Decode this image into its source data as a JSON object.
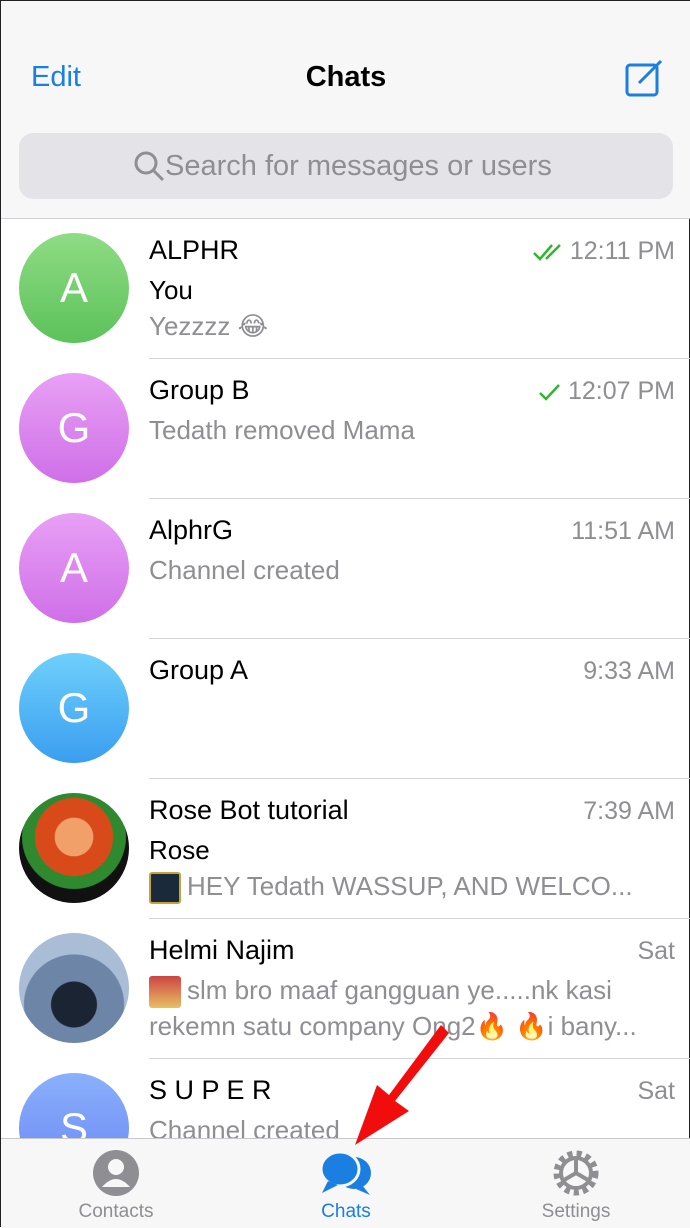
{
  "header": {
    "edit_label": "Edit",
    "title": "Chats",
    "compose_icon": "compose-icon"
  },
  "search": {
    "placeholder": "Search for messages or users"
  },
  "chats": [
    {
      "initial": "A",
      "name": "ALPHR",
      "time": "12:11 PM",
      "status": "read",
      "sender": "You",
      "message": "Yezzzz 😂",
      "color_top": "#8fdc84",
      "color_bottom": "#5cc25a"
    },
    {
      "initial": "G",
      "name": "Group B",
      "time": "12:07 PM",
      "status": "sent",
      "message": "Tedath removed Mama",
      "color_top": "#e8a0f5",
      "color_bottom": "#cf6fe8"
    },
    {
      "initial": "A",
      "name": "AlphrG",
      "time": "11:51 AM",
      "message": "Channel created",
      "color_top": "#e8a0f5",
      "color_bottom": "#cf6fe8"
    },
    {
      "initial": "G",
      "name": "Group A",
      "time": "9:33 AM",
      "message": "",
      "color_top": "#6fd0fb",
      "color_bottom": "#3a9ef0"
    },
    {
      "name": "Rose Bot tutorial",
      "time": "7:39 AM",
      "sender": "Rose",
      "message": "HEY Tedath WASSUP, AND WELCO..."
    },
    {
      "name": "Helmi Najim",
      "time": "Sat",
      "message": "slm bro maaf gangguan ye.....nk kasi",
      "message2": "rekemn satu company Ong2🔥 🔥i bany..."
    },
    {
      "initial": "S",
      "name": "S U P E R",
      "time": "Sat",
      "message": "Channel created",
      "color_top": "#8ab0fb",
      "color_bottom": "#6a86f5"
    }
  ],
  "tabs": [
    {
      "label": "Contacts",
      "icon": "person-icon"
    },
    {
      "label": "Chats",
      "icon": "chat-bubbles-icon",
      "active": true
    },
    {
      "label": "Settings",
      "icon": "gear-icon"
    }
  ],
  "colors": {
    "accent": "#1a7fe0",
    "check": "#2fb52f",
    "annotation_arrow": "#f20d0d"
  }
}
